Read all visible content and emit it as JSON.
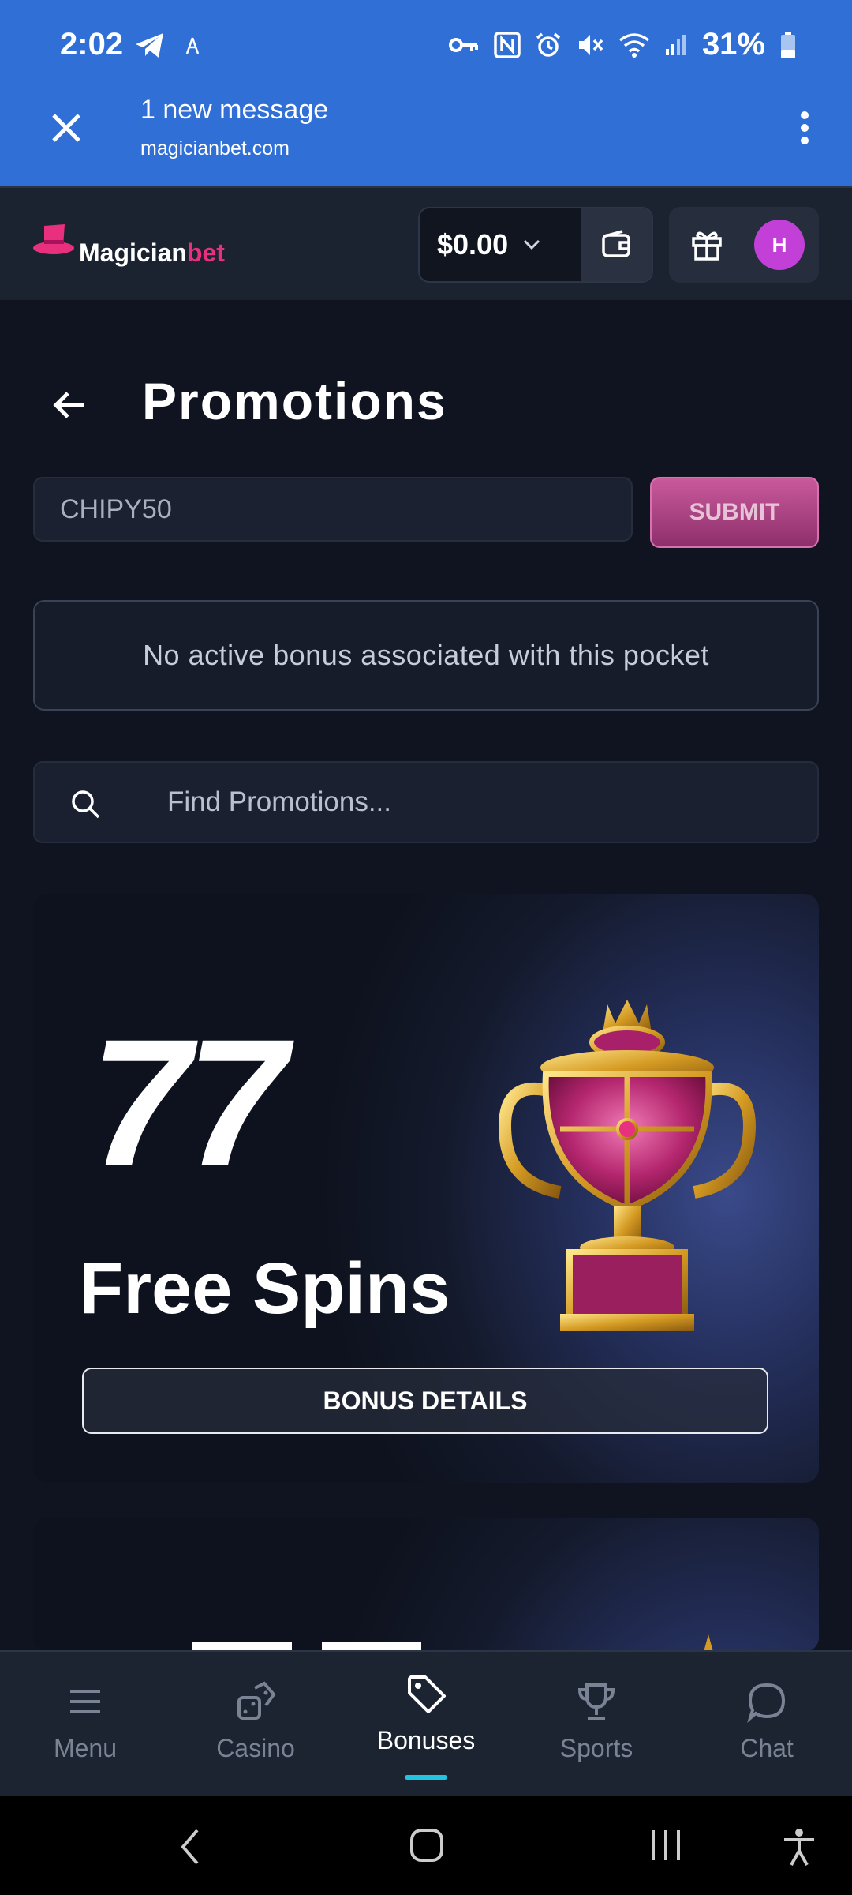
{
  "status_bar": {
    "time": "2:02",
    "battery": "31%"
  },
  "message_bar": {
    "title": "1 new message",
    "url": "magicianbet.com"
  },
  "header": {
    "logo_main": "Magician",
    "logo_accent": "bet",
    "balance": "$0.00",
    "avatar_initial": "H"
  },
  "page": {
    "title": "Promotions"
  },
  "promo_code": {
    "value": "CHIPY50",
    "submit_label": "SUBMIT"
  },
  "notice": "No active bonus associated with this pocket",
  "search": {
    "placeholder": "Find Promotions..."
  },
  "promotions": [
    {
      "number": "77",
      "title": "Free Spins",
      "button": "BONUS DETAILS"
    }
  ],
  "bottom_nav": [
    {
      "label": "Menu",
      "active": false
    },
    {
      "label": "Casino",
      "active": false
    },
    {
      "label": "Bonuses",
      "active": true
    },
    {
      "label": "Sports",
      "active": false
    },
    {
      "label": "Chat",
      "active": false
    }
  ],
  "colors": {
    "status_bar_bg": "#2f6fd6",
    "page_bg": "#0f1420",
    "brand_pink": "#e8307e",
    "submit_pink": "#c95a9c",
    "avatar_purple": "#c23fd8",
    "nav_active_underline": "#22c4e0"
  },
  "icons": [
    "telegram-icon",
    "key-icon",
    "nfc-icon",
    "alarm-icon",
    "mute-icon",
    "wifi-icon",
    "signal-icon",
    "battery-icon",
    "close-icon",
    "more-vert-icon",
    "wallet-icon",
    "gift-icon",
    "back-arrow-icon",
    "search-icon",
    "menu-icon",
    "dice-icon",
    "tag-icon",
    "trophy-icon",
    "chat-icon"
  ]
}
